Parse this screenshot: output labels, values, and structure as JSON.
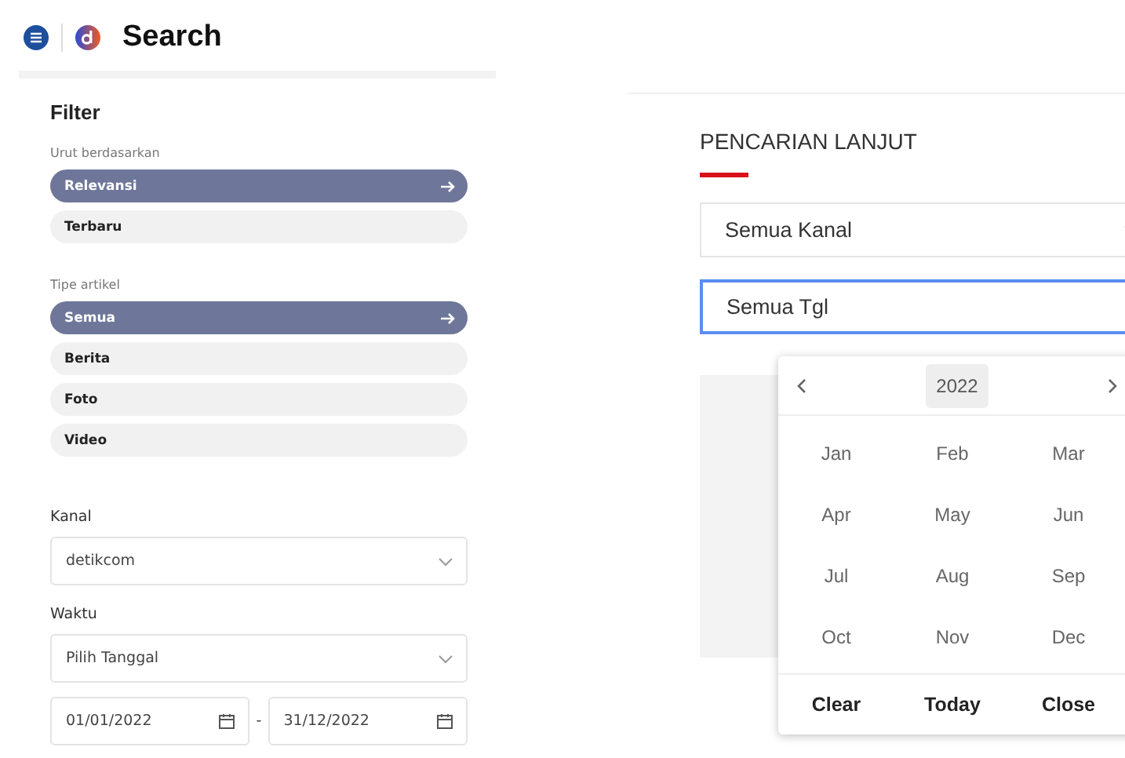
{
  "header": {
    "title": "Search"
  },
  "filter": {
    "title": "Filter",
    "sort": {
      "label": "Urut berdasarkan",
      "options": [
        {
          "label": "Relevansi",
          "selected": true
        },
        {
          "label": "Terbaru",
          "selected": false
        }
      ]
    },
    "type": {
      "label": "Tipe artikel",
      "options": [
        {
          "label": "Semua",
          "selected": true
        },
        {
          "label": "Berita",
          "selected": false
        },
        {
          "label": "Foto",
          "selected": false
        },
        {
          "label": "Video",
          "selected": false
        }
      ]
    },
    "channel": {
      "label": "Kanal",
      "value": "detikcom"
    },
    "time": {
      "label": "Waktu",
      "value": "Pilih Tanggal",
      "from": "01/01/2022",
      "separator": "-",
      "to": "31/12/2022"
    }
  },
  "advanced": {
    "title": "PENCARIAN LANJUT",
    "channel": "Semua Kanal",
    "date": "Semua Tgl",
    "picker": {
      "year": "2022",
      "months": [
        "Jan",
        "Feb",
        "Mar",
        "Apr",
        "May",
        "Jun",
        "Jul",
        "Aug",
        "Sep",
        "Oct",
        "Nov",
        "Dec"
      ],
      "buttons": [
        "Clear",
        "Today",
        "Close"
      ]
    }
  }
}
